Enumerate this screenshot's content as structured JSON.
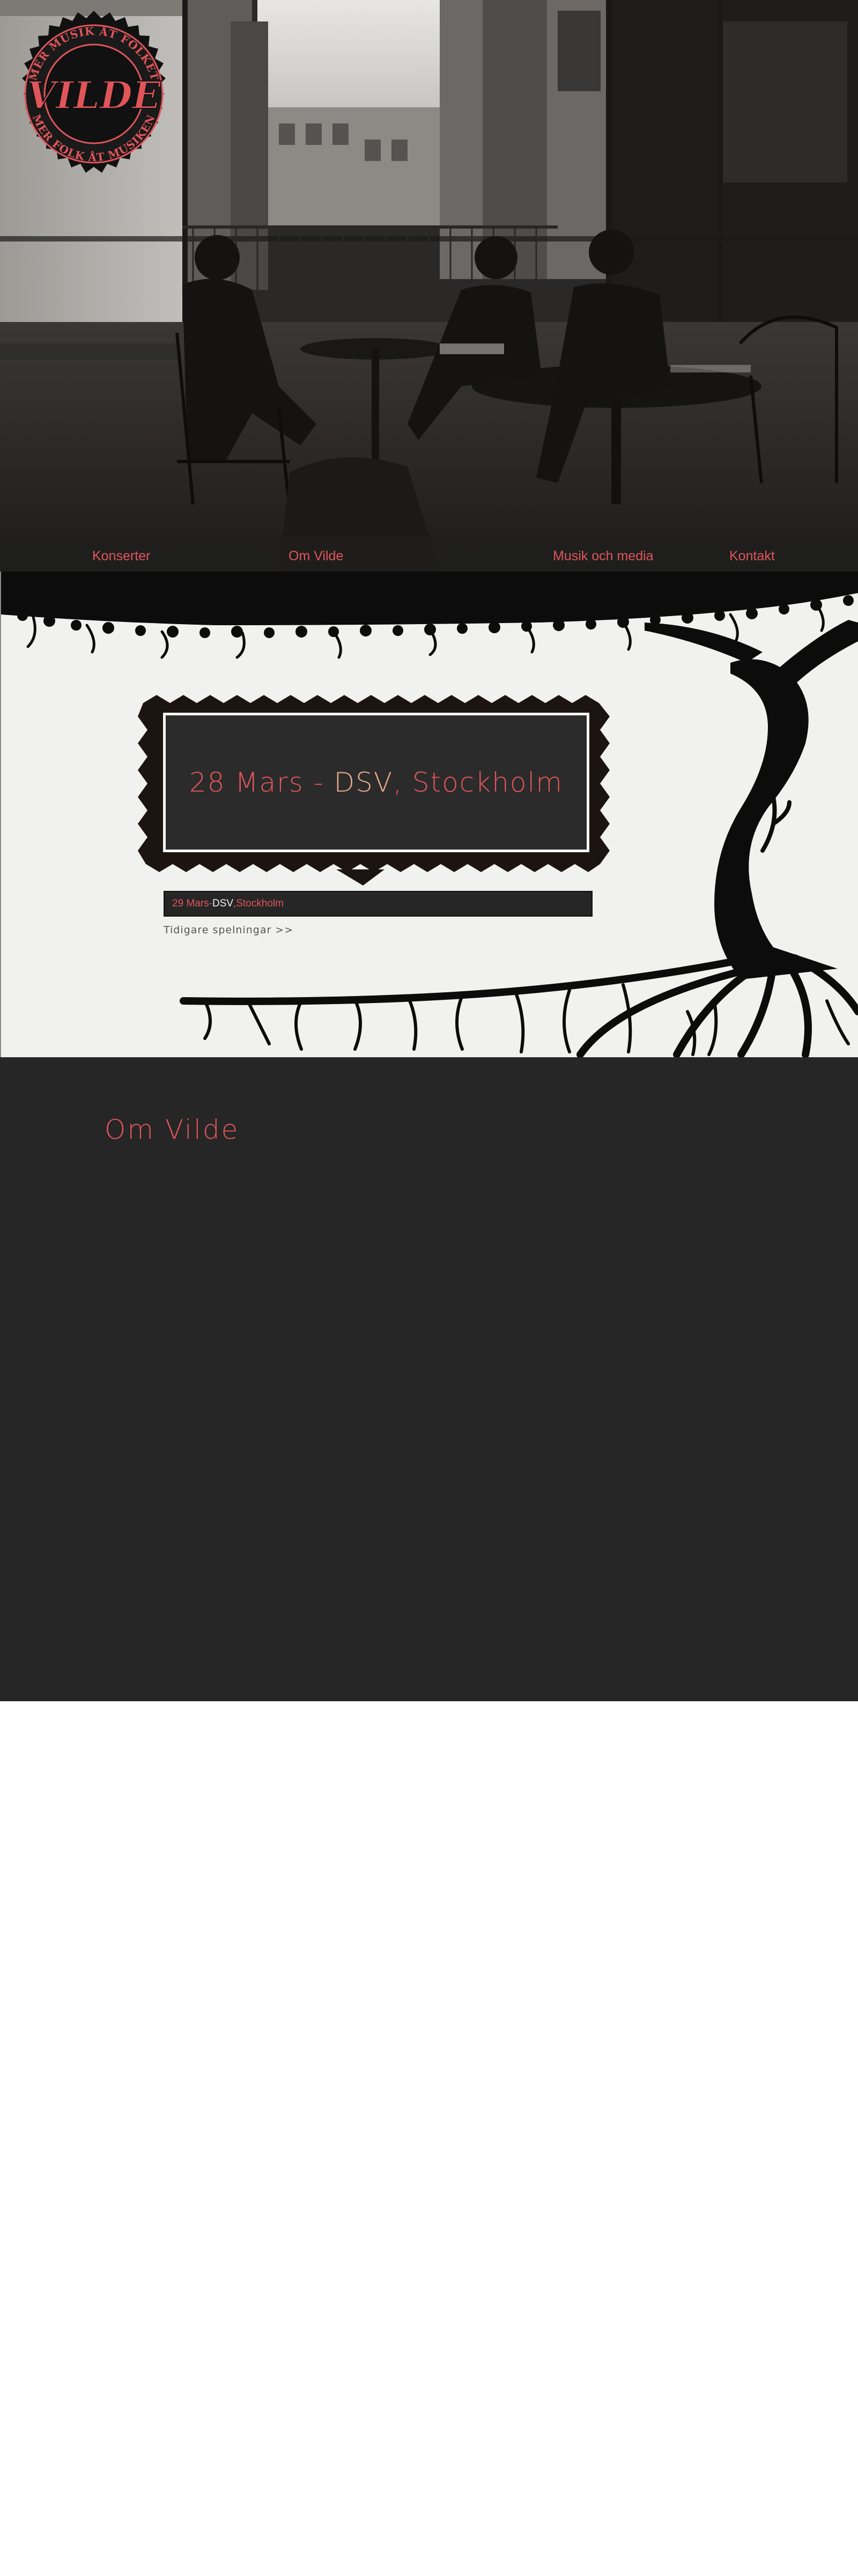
{
  "logo": {
    "top_text": "MER MUSIK ÅT FOLKET",
    "bottom_text": "MER FOLK ÅT MUSIKEN",
    "name": "VILDE"
  },
  "nav": {
    "items": [
      {
        "label": "Konserter"
      },
      {
        "label": "Om Vilde"
      },
      {
        "label": "Musik och media"
      },
      {
        "label": "Kontakt"
      }
    ]
  },
  "next_concert": {
    "date": "28 Mars",
    "separator": " - ",
    "venue": "DSV",
    "city_sep": ", ",
    "city": "Stockholm"
  },
  "gig_list": [
    {
      "date": "29 Mars",
      "separator": " - ",
      "venue": "DSV",
      "city_sep": ", ",
      "city": "Stockholm"
    }
  ],
  "earlier_link": "Tidigare spelningar >>",
  "about": {
    "title": "Om Vilde"
  },
  "colors": {
    "accent": "#e0555a",
    "venue": "#e8a98a",
    "dark": "#262626",
    "light": "#f1f1ef"
  },
  "icons": [
    "vilde-logo",
    "tree-illustration",
    "hero-photo"
  ]
}
